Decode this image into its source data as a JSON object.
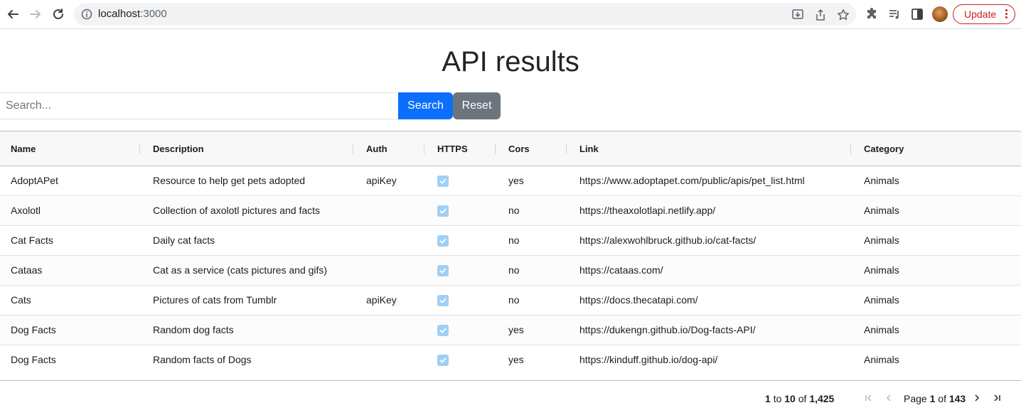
{
  "browser": {
    "url_host": "localhost",
    "url_port": ":3000",
    "update_label": "Update",
    "accent": "#c5221f"
  },
  "page": {
    "title": "API results",
    "search": {
      "placeholder": "Search...",
      "value": ""
    },
    "search_button": "Search",
    "reset_button": "Reset"
  },
  "grid": {
    "columns": [
      "Name",
      "Description",
      "Auth",
      "HTTPS",
      "Cors",
      "Link",
      "Category"
    ],
    "rows": [
      {
        "name": "AdoptAPet",
        "description": "Resource to help get pets adopted",
        "auth": "apiKey",
        "https": true,
        "cors": "yes",
        "link": "https://www.adoptapet.com/public/apis/pet_list.html",
        "category": "Animals"
      },
      {
        "name": "Axolotl",
        "description": "Collection of axolotl pictures and facts",
        "auth": "",
        "https": true,
        "cors": "no",
        "link": "https://theaxolotlapi.netlify.app/",
        "category": "Animals"
      },
      {
        "name": "Cat Facts",
        "description": "Daily cat facts",
        "auth": "",
        "https": true,
        "cors": "no",
        "link": "https://alexwohlbruck.github.io/cat-facts/",
        "category": "Animals"
      },
      {
        "name": "Cataas",
        "description": "Cat as a service (cats pictures and gifs)",
        "auth": "",
        "https": true,
        "cors": "no",
        "link": "https://cataas.com/",
        "category": "Animals"
      },
      {
        "name": "Cats",
        "description": "Pictures of cats from Tumblr",
        "auth": "apiKey",
        "https": true,
        "cors": "no",
        "link": "https://docs.thecatapi.com/",
        "category": "Animals"
      },
      {
        "name": "Dog Facts",
        "description": "Random dog facts",
        "auth": "",
        "https": true,
        "cors": "yes",
        "link": "https://dukengn.github.io/Dog-facts-API/",
        "category": "Animals"
      },
      {
        "name": "Dog Facts",
        "description": "Random facts of Dogs",
        "auth": "",
        "https": true,
        "cors": "yes",
        "link": "https://kinduff.github.io/dog-api/",
        "category": "Animals"
      }
    ],
    "footer": {
      "range_start": "1",
      "to_word": "to",
      "range_end": "10",
      "of_word": "of",
      "total": "1,425",
      "page_word": "Page",
      "page_current": "1",
      "page_of": "of",
      "page_total": "143"
    }
  },
  "colors": {
    "primary": "#0d6efd",
    "secondary": "#6c757d",
    "checkbox": "#a0cff5"
  }
}
